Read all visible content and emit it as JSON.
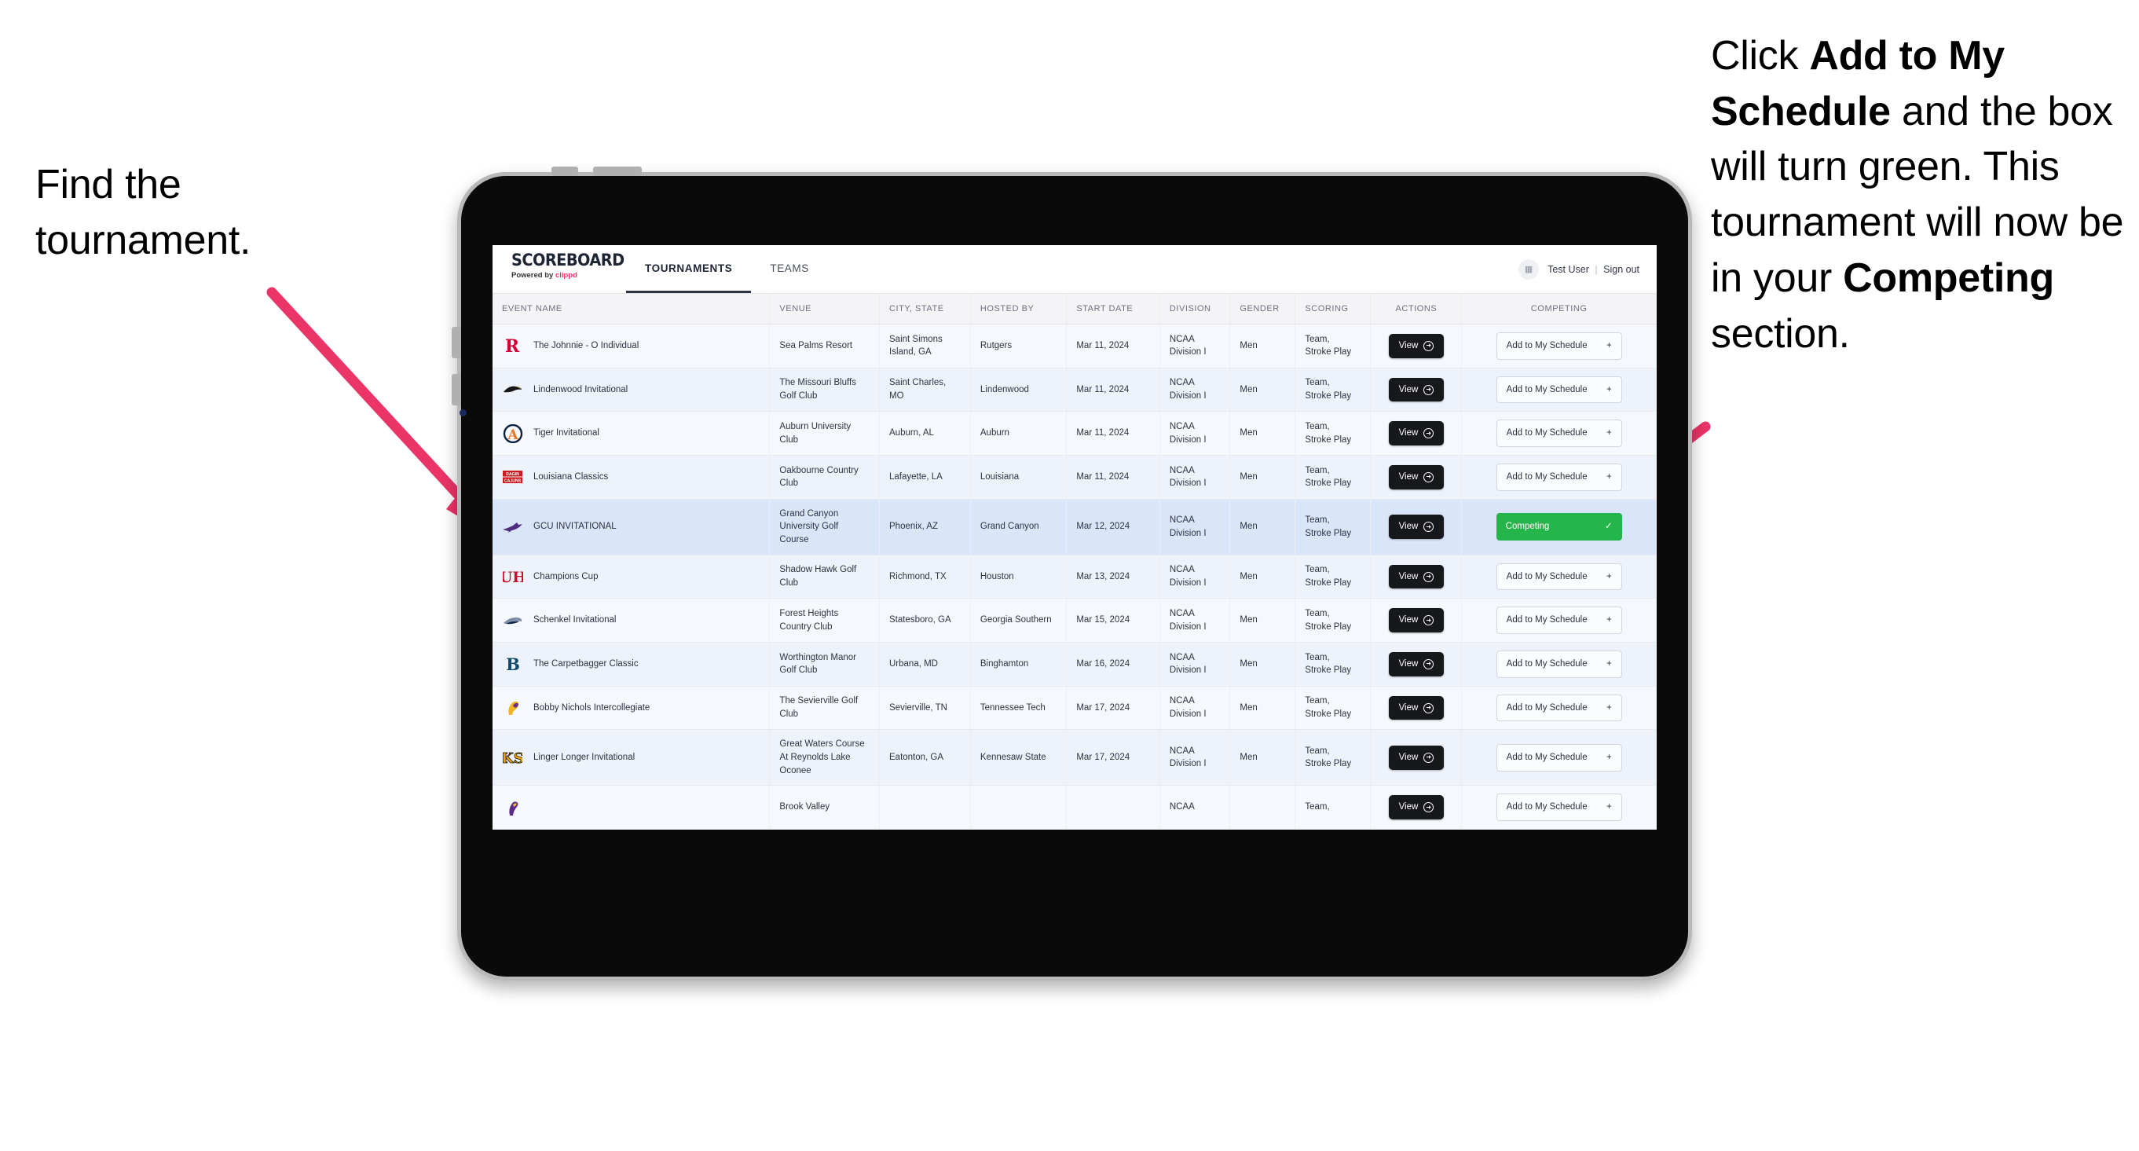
{
  "annotations": {
    "left": {
      "line1": "Find the",
      "line2": "tournament."
    },
    "right": {
      "p1_pre": "Click ",
      "p1_bold": "Add to My Schedule",
      "p1_post": " and the box will turn green. This tournament will now be in your ",
      "p2_bold": "Competing",
      "p2_post": " section."
    },
    "arrow_color": "#eb3468"
  },
  "app": {
    "brand": {
      "title": "SCOREBOARD",
      "powered_prefix": "Powered by ",
      "powered_brand": "clippd"
    },
    "tabs": [
      {
        "label": "TOURNAMENTS",
        "active": true
      },
      {
        "label": "TEAMS",
        "active": false
      }
    ],
    "user": {
      "avatar_icon": "user-avatar-icon",
      "name": "Test User",
      "separator": "|",
      "signout": "Sign out"
    },
    "table": {
      "columns": [
        "EVENT NAME",
        "VENUE",
        "CITY, STATE",
        "HOSTED BY",
        "START DATE",
        "DIVISION",
        "GENDER",
        "SCORING",
        "ACTIONS",
        "COMPETING"
      ],
      "view_label": "View",
      "add_label": "Add to My Schedule",
      "add_icon": "plus-icon",
      "competing_label": "Competing",
      "competing_icon": "check-icon",
      "competing_color": "#24b54b",
      "rows": [
        {
          "event": "The Johnnie - O Individual",
          "logo": "rutgers-logo",
          "venue": "Sea Palms Resort",
          "city": "Saint Simons Island, GA",
          "host": "Rutgers",
          "date": "Mar 11, 2024",
          "division": "NCAA Division I",
          "gender": "Men",
          "scoring": "Team, Stroke Play",
          "competing": false
        },
        {
          "event": "Lindenwood Invitational",
          "logo": "lindenwood-logo",
          "venue": "The Missouri Bluffs Golf Club",
          "city": "Saint Charles, MO",
          "host": "Lindenwood",
          "date": "Mar 11, 2024",
          "division": "NCAA Division I",
          "gender": "Men",
          "scoring": "Team, Stroke Play",
          "competing": false
        },
        {
          "event": "Tiger Invitational",
          "logo": "auburn-logo",
          "venue": "Auburn University Club",
          "city": "Auburn, AL",
          "host": "Auburn",
          "date": "Mar 11, 2024",
          "division": "NCAA Division I",
          "gender": "Men",
          "scoring": "Team, Stroke Play",
          "competing": false
        },
        {
          "event": "Louisiana Classics",
          "logo": "ragin-cajuns-logo",
          "venue": "Oakbourne Country Club",
          "city": "Lafayette, LA",
          "host": "Louisiana",
          "date": "Mar 11, 2024",
          "division": "NCAA Division I",
          "gender": "Men",
          "scoring": "Team, Stroke Play",
          "competing": false
        },
        {
          "event": "GCU INVITATIONAL",
          "logo": "gcu-lopes-logo",
          "venue": "Grand Canyon University Golf Course",
          "city": "Phoenix, AZ",
          "host": "Grand Canyon",
          "date": "Mar 12, 2024",
          "division": "NCAA Division I",
          "gender": "Men",
          "scoring": "Team, Stroke Play",
          "competing": true
        },
        {
          "event": "Champions Cup",
          "logo": "houston-logo",
          "venue": "Shadow Hawk Golf Club",
          "city": "Richmond, TX",
          "host": "Houston",
          "date": "Mar 13, 2024",
          "division": "NCAA Division I",
          "gender": "Men",
          "scoring": "Team, Stroke Play",
          "competing": false
        },
        {
          "event": "Schenkel Invitational",
          "logo": "georgia-southern-logo",
          "venue": "Forest Heights Country Club",
          "city": "Statesboro, GA",
          "host": "Georgia Southern",
          "date": "Mar 15, 2024",
          "division": "NCAA Division I",
          "gender": "Men",
          "scoring": "Team, Stroke Play",
          "competing": false
        },
        {
          "event": "The Carpetbagger Classic",
          "logo": "binghamton-logo",
          "venue": "Worthington Manor Golf Club",
          "city": "Urbana, MD",
          "host": "Binghamton",
          "date": "Mar 16, 2024",
          "division": "NCAA Division I",
          "gender": "Men",
          "scoring": "Team, Stroke Play",
          "competing": false
        },
        {
          "event": "Bobby Nichols Intercollegiate",
          "logo": "tennessee-tech-logo",
          "venue": "The Sevierville Golf Club",
          "city": "Sevierville, TN",
          "host": "Tennessee Tech",
          "date": "Mar 17, 2024",
          "division": "NCAA Division I",
          "gender": "Men",
          "scoring": "Team, Stroke Play",
          "competing": false
        },
        {
          "event": "Linger Longer Invitational",
          "logo": "kennesaw-state-logo",
          "venue": "Great Waters Course At Reynolds Lake Oconee",
          "city": "Eatonton, GA",
          "host": "Kennesaw State",
          "date": "Mar 17, 2024",
          "division": "NCAA Division I",
          "gender": "Men",
          "scoring": "Team, Stroke Play",
          "competing": false
        },
        {
          "event": "",
          "logo": "east-carolina-logo",
          "venue": "Brook Valley",
          "city": "",
          "host": "",
          "date": "",
          "division": "NCAA",
          "gender": "",
          "scoring": "Team,",
          "competing": false
        }
      ]
    }
  }
}
